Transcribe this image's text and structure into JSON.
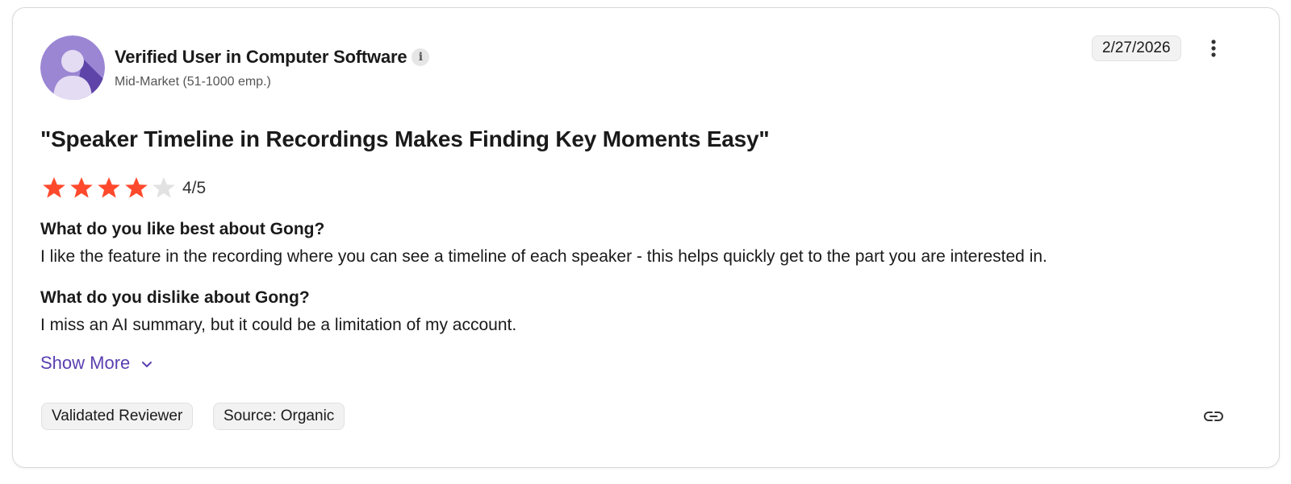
{
  "reviewer": {
    "name": "Verified User in Computer Software",
    "segment": "Mid-Market (51-1000 emp.)",
    "info_icon": "info-icon",
    "info_glyph": "i"
  },
  "review": {
    "date": "2/27/2026",
    "title": "\"Speaker Timeline in Recordings Makes Finding Key Moments Easy\"",
    "rating": 4,
    "rating_max": 5,
    "rating_text": "4/5",
    "questions": [
      {
        "question": "What do you like best about Gong?",
        "answer": "I like the feature in the recording where you can see a timeline of each speaker - this helps quickly get to the part you are interested in."
      },
      {
        "question": "What do you dislike about Gong?",
        "answer": "I miss an AI summary, but it could be a limitation of my account."
      }
    ],
    "show_more_label": "Show More",
    "tags": [
      {
        "label": "Validated Reviewer"
      },
      {
        "label": "Source: Organic"
      }
    ]
  },
  "icons": {
    "more": "more-vertical-icon",
    "chevron": "chevron-down-icon",
    "link": "link-icon",
    "star": "star-icon"
  },
  "colors": {
    "star_filled": "#ff492c",
    "star_empty": "#e2e2e2",
    "accent": "#5a3fb0",
    "avatar_bg": "#9b86d4"
  }
}
